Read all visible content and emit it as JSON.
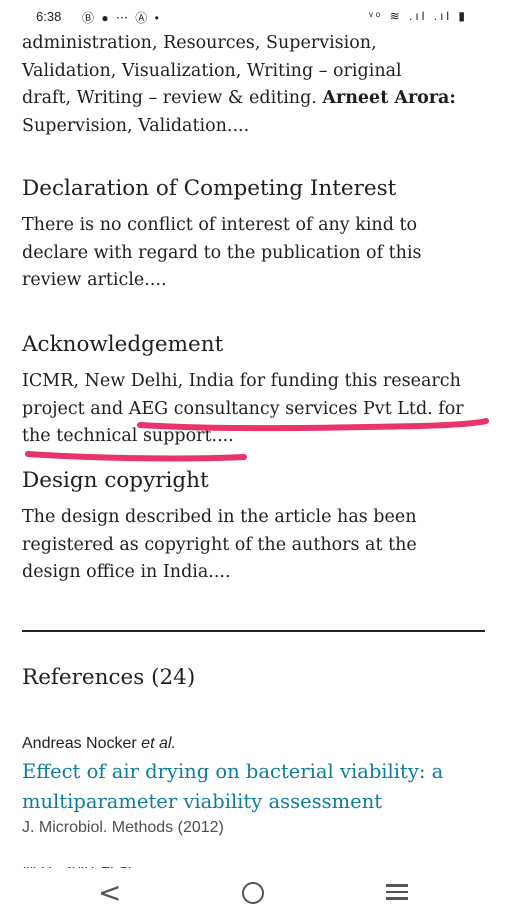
{
  "status_bar": {
    "time": "6:38",
    "notification_icons": "Ⓑ ● ⋯ Ⓐ •",
    "system_icons": "ᵛᵒ ≋ .ıl .ıl ▮"
  },
  "contributions": {
    "line1": "administration, Resources, Supervision,",
    "line2": "Validation, Visualization, Writing – original",
    "line3a": "draft, Writing – review & editing. ",
    "line3_bold": "Arneet Arora:",
    "line4": "Supervision, Validation...."
  },
  "competing_interest": {
    "heading": "Declaration of Competing Interest",
    "line1": "There is no conflict of interest of any kind to",
    "line2": "declare with regard to the publication of this",
    "line3": "review article...."
  },
  "acknowledgement": {
    "heading": "Acknowledgement",
    "line1": "ICMR, New Delhi, India for funding this research",
    "line2": "project and AEG consultancy services Pvt Ltd. for",
    "line3": "the technical support...."
  },
  "design_copyright": {
    "heading": "Design copyright",
    "line1": "The design described in the article has been",
    "line2": "registered as copyright of the authors at the",
    "line3": "design office in India...."
  },
  "references": {
    "heading": "References (24)",
    "items": [
      {
        "author": "Andreas Nocker",
        "etal": "et al.",
        "title_line1": "Effect of air drying on bacterial viability: a",
        "title_line2": "multiparameter viability assessment",
        "journal": "J. Microbiol. Methods (2012)"
      }
    ],
    "next_author_partial": "W.H. Spitz et al."
  },
  "highlight_color": "#e8336b",
  "link_color": "#0c7d9d",
  "nav": {
    "back_glyph": "<",
    "home": "home",
    "recents": "recents"
  }
}
